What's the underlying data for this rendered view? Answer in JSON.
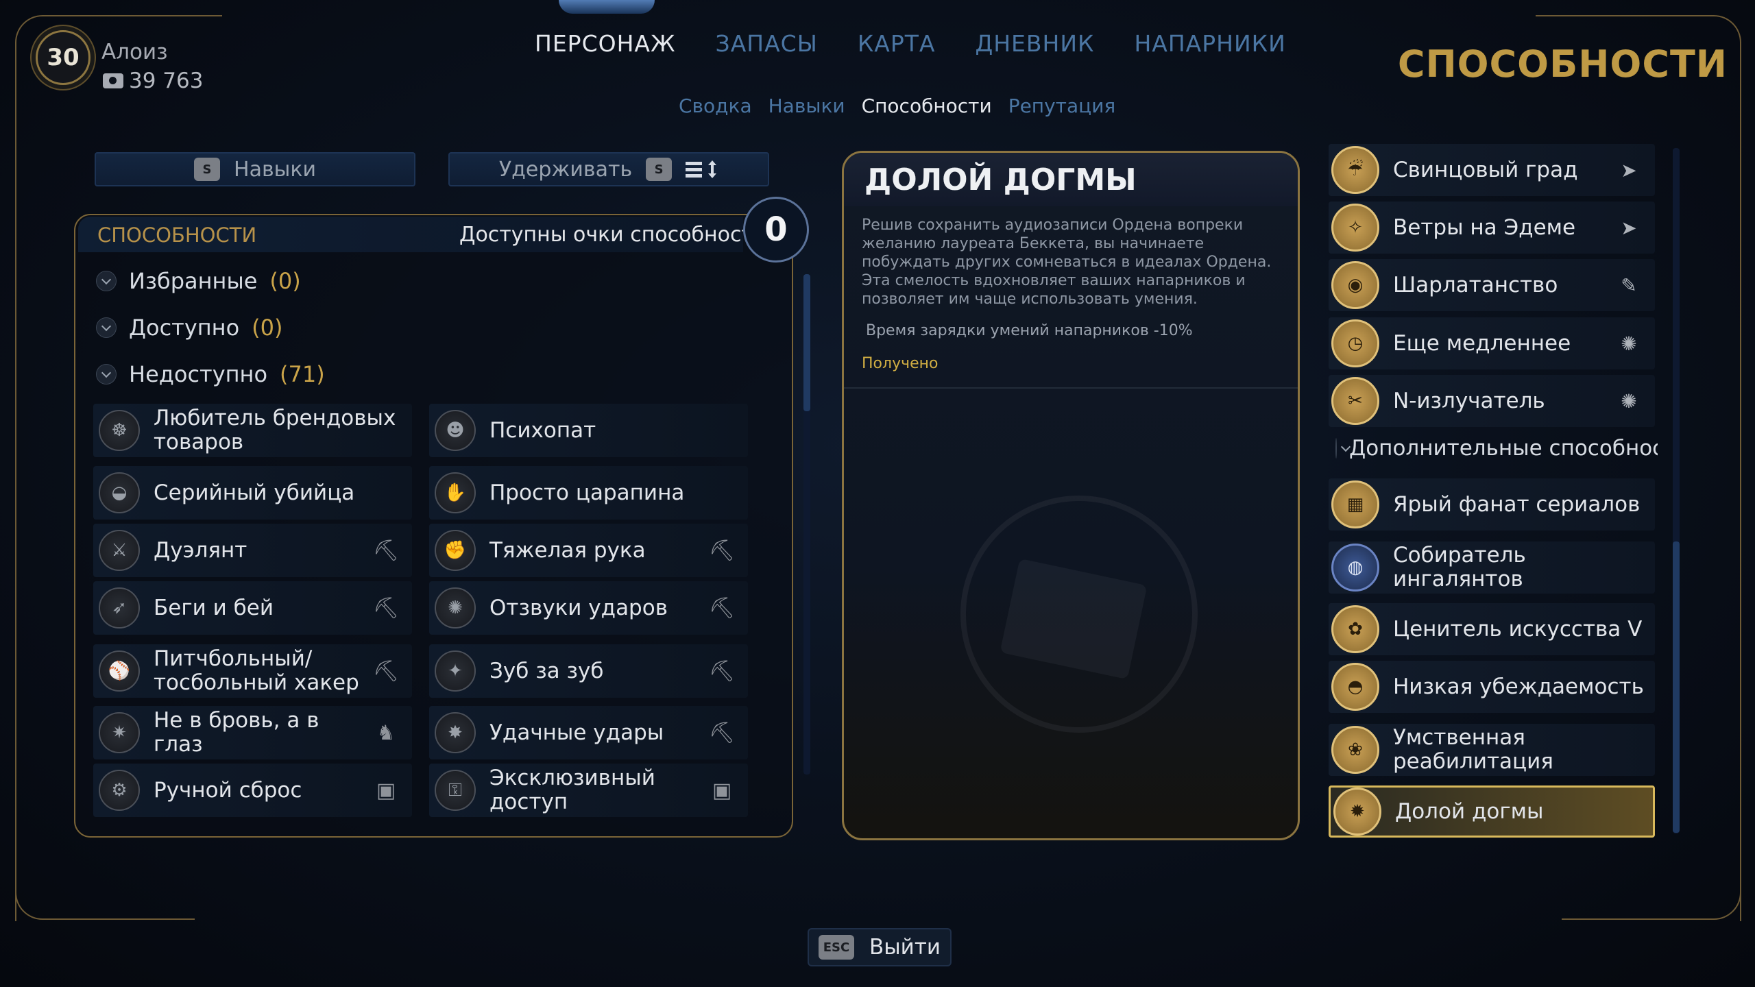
{
  "player": {
    "level": "30",
    "name": "Алоиз",
    "money": "39 763"
  },
  "nav": {
    "tabs": [
      "ПЕРСОНАЖ",
      "ЗАПАСЫ",
      "КАРТА",
      "ДНЕВНИК",
      "НАПАРНИКИ"
    ],
    "active": "ПЕРСОНАЖ"
  },
  "subnav": {
    "tabs": [
      "Сводка",
      "Навыки",
      "Способности",
      "Репутация"
    ],
    "active": "Способности"
  },
  "page_title": "СПОСОБНОСТИ",
  "left_buttons": {
    "skills": {
      "key": "S",
      "label": "Навыки"
    },
    "hold": {
      "label": "Удерживать",
      "key": "S",
      "icon": "sort-icon"
    }
  },
  "abilities_panel": {
    "header": "СПОСОБНОСТИ",
    "points_label": "Доступны очки способностей:",
    "points": "0",
    "categories": [
      {
        "label": "Избранные",
        "count": "(0)"
      },
      {
        "label": "Доступно",
        "count": "(0)"
      },
      {
        "label": "Недоступно",
        "count": "(71)"
      }
    ],
    "tiles": [
      {
        "label": "Любитель брендовых товаров",
        "icon": "crowd-icon",
        "badge": ""
      },
      {
        "label": "Психопат",
        "icon": "mask-icon",
        "badge": ""
      },
      {
        "label": "Серийный убийца",
        "icon": "bowl-icon",
        "badge": ""
      },
      {
        "label": "Просто царапина",
        "icon": "hand-icon",
        "badge": ""
      },
      {
        "label": "Дуэлянт",
        "icon": "crossed-swords-icon",
        "badge": "pickaxe-icon"
      },
      {
        "label": "Тяжелая рука",
        "icon": "arms-icon",
        "badge": "pickaxe-icon"
      },
      {
        "label": "Беги и бей",
        "icon": "runner-icon",
        "badge": "pickaxe-icon"
      },
      {
        "label": "Отзвуки ударов",
        "icon": "burst-icon",
        "badge": "pickaxe-icon"
      },
      {
        "label": "Питчбольный/ тосбольный хакер",
        "icon": "bat-icon",
        "badge": "pickaxe-icon"
      },
      {
        "label": "Зуб за зуб",
        "icon": "fight-icon",
        "badge": "pickaxe-icon"
      },
      {
        "label": "Не в бровь, а в глаз",
        "icon": "strike-icon",
        "badge": "figure-icon"
      },
      {
        "label": "Удачные удары",
        "icon": "splash-icon",
        "badge": "pickaxe-icon"
      },
      {
        "label": "Ручной сброс",
        "icon": "robot-icon",
        "badge": "device-icon"
      },
      {
        "label": "Эксклюзивный доступ",
        "icon": "key-icon",
        "badge": "device-icon"
      }
    ]
  },
  "detail": {
    "title": "ДОЛОЙ ДОГМЫ",
    "description": "Решив сохранить аудиозаписи Ордена вопреки желанию лауреата Беккета, вы начинаете побуждать других сомневаться в идеалах Ордена. Эта смелость вдохновляет ваших напарников и позволяет им чаще использовать умения.",
    "effect": "Время зарядки умений напарников -10%",
    "status": "Получено"
  },
  "right_list": {
    "items_top": [
      {
        "label": "Свинцовый град",
        "icon": "rain-icon",
        "badge": "gun-icon"
      },
      {
        "label": "Ветры на Эдеме",
        "icon": "compass-icon",
        "badge": "gun-icon"
      },
      {
        "label": "Шарлатанство",
        "icon": "eye-icon",
        "badge": "speech-icon"
      },
      {
        "label": "Еще медленнее",
        "icon": "clock-icon",
        "badge": "atom-icon"
      },
      {
        "label": "N-излучатель",
        "icon": "tools-icon",
        "badge": "atom-icon"
      }
    ],
    "category": "Дополнительные способности",
    "items_bottom": [
      {
        "label": "Ярый фанат сериалов",
        "icon": "tv-icon",
        "badge": "",
        "style": "gold"
      },
      {
        "label": "Собиратель ингалянтов",
        "icon": "inhaler-icon",
        "badge": "",
        "style": "blue"
      },
      {
        "label": "Ценитель искусства V",
        "icon": "palette-icon",
        "badge": "",
        "style": "gold"
      },
      {
        "label": "Низкая убеждаемость",
        "icon": "bag-icon",
        "badge": "",
        "style": "gold"
      },
      {
        "label": "Умственная реабилитация",
        "icon": "brain-icon",
        "badge": "",
        "style": "gold"
      },
      {
        "label": "Долой догмы",
        "icon": "dogma-icon",
        "badge": "",
        "style": "gold",
        "selected": true
      }
    ]
  },
  "footer": {
    "key": "ESC",
    "label": "Выйти"
  },
  "colors": {
    "accent_gold": "#c8a24e",
    "nav_inactive": "#4b76a3",
    "nav_active": "#e6e9ee",
    "status_gold": "#d1ae43"
  }
}
